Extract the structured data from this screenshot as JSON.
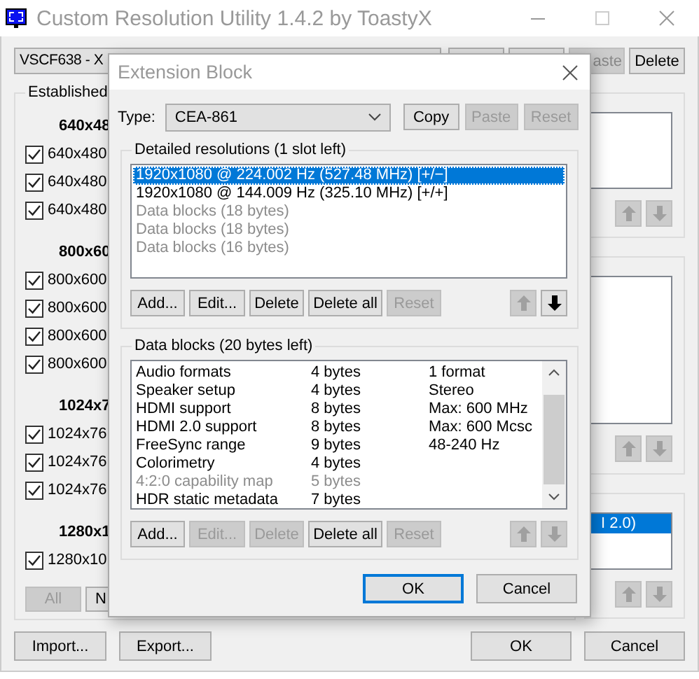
{
  "window": {
    "title": "Custom Resolution Utility 1.4.2 by ToastyX"
  },
  "monitor_select": {
    "value": "VSCF638 - X"
  },
  "toolbar_buttons": [
    {
      "label": "aste",
      "disabled": true
    },
    {
      "label": "Delete",
      "disabled": false
    }
  ],
  "established": {
    "title": "Established",
    "groups": [
      {
        "heading": "640x48",
        "items": [
          {
            "label": "640x480",
            "checked": true
          },
          {
            "label": "640x480",
            "checked": true
          },
          {
            "label": "640x480",
            "checked": true
          }
        ]
      },
      {
        "heading": "800x60",
        "items": [
          {
            "label": "800x600",
            "checked": true
          },
          {
            "label": "800x600",
            "checked": true
          },
          {
            "label": "800x600",
            "checked": true
          },
          {
            "label": "800x600",
            "checked": true
          }
        ]
      },
      {
        "heading": "1024x7",
        "items": [
          {
            "label": "1024x76",
            "checked": true
          },
          {
            "label": "1024x76",
            "checked": true
          },
          {
            "label": "1024x76",
            "checked": true
          }
        ]
      },
      {
        "heading": "1280x1",
        "items": [
          {
            "label": "1280x10",
            "checked": true
          }
        ]
      }
    ],
    "buttons": [
      {
        "label": "All",
        "disabled": true
      },
      {
        "label": "N",
        "disabled": false
      }
    ]
  },
  "right_panels": [
    {
      "move_buttons": [
        {
          "kind": "up",
          "disabled": true
        },
        {
          "kind": "down",
          "disabled": true
        }
      ]
    },
    {
      "move_buttons": [
        {
          "kind": "up",
          "disabled": true
        },
        {
          "kind": "down",
          "disabled": true
        }
      ]
    },
    {
      "rows": [
        {
          "text": "I 2.0)",
          "selected": true
        }
      ],
      "move_buttons": [
        {
          "kind": "up",
          "disabled": true
        },
        {
          "kind": "down",
          "disabled": true
        }
      ]
    }
  ],
  "bottom_buttons": [
    {
      "label": "Import...",
      "kind": "left"
    },
    {
      "label": "Export...",
      "kind": "left"
    },
    {
      "label": "OK",
      "kind": "right"
    },
    {
      "label": "Cancel",
      "kind": "right"
    }
  ],
  "dialog": {
    "title": "Extension Block",
    "type_label": "Type:",
    "type_value": "CEA-861",
    "type_buttons": [
      {
        "label": "Copy",
        "disabled": false
      },
      {
        "label": "Paste",
        "disabled": true
      },
      {
        "label": "Reset",
        "disabled": true
      }
    ],
    "detailed": {
      "title": "Detailed resolutions (1 slot left)",
      "rows": [
        {
          "text": "1920x1080 @ 224.002 Hz (527.48 MHz) [+/−]",
          "selected": true,
          "disabled": false
        },
        {
          "text": "1920x1080 @ 144.009 Hz (325.10 MHz) [+/+]",
          "selected": false,
          "disabled": false
        },
        {
          "text": "Data blocks (18 bytes)",
          "selected": false,
          "disabled": true
        },
        {
          "text": "Data blocks (18 bytes)",
          "selected": false,
          "disabled": true
        },
        {
          "text": "Data blocks (16 bytes)",
          "selected": false,
          "disabled": true
        }
      ],
      "buttons": [
        {
          "label": "Add...",
          "disabled": false
        },
        {
          "label": "Edit...",
          "disabled": false
        },
        {
          "label": "Delete",
          "disabled": false
        },
        {
          "label": "Delete all",
          "disabled": false
        },
        {
          "label": "Reset",
          "disabled": true
        }
      ],
      "move_buttons": [
        {
          "kind": "up",
          "disabled": true
        },
        {
          "kind": "down",
          "disabled": false
        }
      ]
    },
    "data_blocks": {
      "title": "Data blocks (20 bytes left)",
      "rows": [
        {
          "name": "Audio formats",
          "size": "4 bytes",
          "info": "1 format",
          "disabled": false
        },
        {
          "name": "Speaker setup",
          "size": "4 bytes",
          "info": "Stereo",
          "disabled": false
        },
        {
          "name": "HDMI support",
          "size": "8 bytes",
          "info": "Max: 600 MHz",
          "disabled": false
        },
        {
          "name": "HDMI 2.0 support",
          "size": "8 bytes",
          "info": "Max: 600 Mcsc",
          "disabled": false
        },
        {
          "name": "FreeSync range",
          "size": "9 bytes",
          "info": "48-240 Hz",
          "disabled": false
        },
        {
          "name": "Colorimetry",
          "size": "4 bytes",
          "disabled": false
        },
        {
          "name": "4:2:0 capability map",
          "size": "5 bytes",
          "disabled": true
        },
        {
          "name": "HDR static metadata",
          "size": "7 bytes",
          "disabled": false
        }
      ],
      "buttons": [
        {
          "label": "Add...",
          "disabled": false
        },
        {
          "label": "Edit...",
          "disabled": true
        },
        {
          "label": "Delete",
          "disabled": true
        },
        {
          "label": "Delete all",
          "disabled": false
        },
        {
          "label": "Reset",
          "disabled": true
        }
      ],
      "move_buttons": [
        {
          "kind": "up",
          "disabled": true
        },
        {
          "kind": "down",
          "disabled": true
        }
      ]
    },
    "buttons": [
      {
        "label": "OK",
        "default": true
      },
      {
        "label": "Cancel",
        "default": false
      }
    ]
  }
}
